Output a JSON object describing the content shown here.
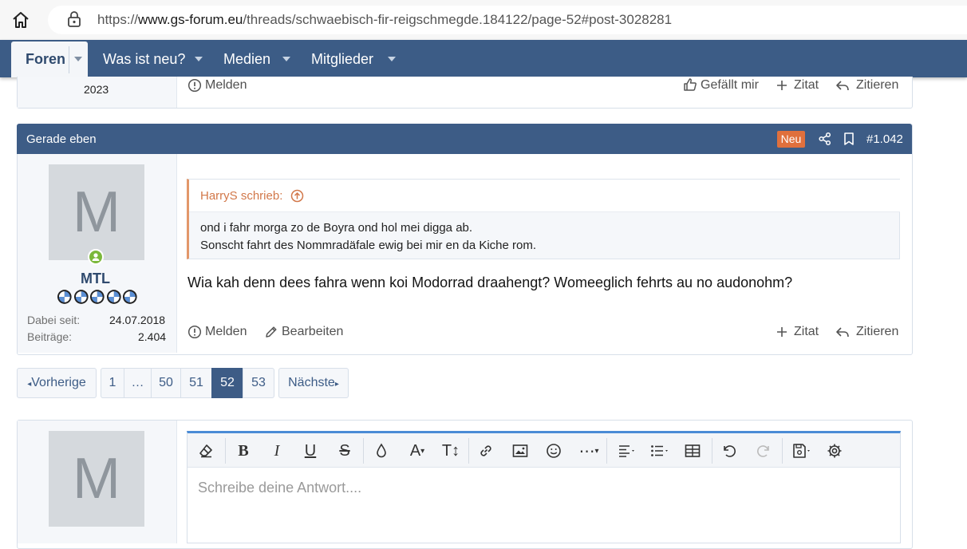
{
  "browser": {
    "url_prefix": "https://",
    "url_host": "www.gs-forum.eu",
    "url_path": "/threads/schwaebisch-fir-reigschmegde.184122/page-52#post-3028281"
  },
  "nav": {
    "items": [
      "Foren",
      "Was ist neu?",
      "Medien",
      "Mitglieder"
    ]
  },
  "prev_post": {
    "user_year": "2023",
    "report_label": "Melden",
    "like_label": "Gefällt mir",
    "add_quote_label": "Zitat",
    "reply_label": "Zitieren"
  },
  "post": {
    "time": "Gerade eben",
    "new_badge": "Neu",
    "number": "#1.042",
    "avatar_letter": "M",
    "username": "MTL",
    "joined_label": "Dabei seit:",
    "joined_value": "24.07.2018",
    "posts_label": "Beiträge:",
    "posts_value": "2.404",
    "quote_author": "HarryS schrieb:",
    "quote_lines": [
      "ond i fahr morga zo de Boyra ond hol mei digga ab.",
      "Sonscht fahrt des Nommradäfale ewig bei mir en da Kiche rom."
    ],
    "body": "Wia kah denn dees fahra wenn koi Modorrad draahengt? Womeeglich fehrts au no audonohm?",
    "report_label": "Melden",
    "edit_label": "Bearbeiten",
    "add_quote_label": "Zitat",
    "reply_label": "Zitieren"
  },
  "pagination": {
    "prev_label": "Vorherige",
    "next_label": "Nächste",
    "pages": [
      "1",
      "…",
      "50",
      "51",
      "52",
      "53"
    ],
    "current": "52"
  },
  "reply": {
    "avatar_letter": "M",
    "placeholder": "Schreibe deine Antwort...."
  },
  "colors": {
    "nav_bg": "#3c5c86",
    "new_badge": "#e0703d",
    "quote_accent": "#e2976a",
    "username": "#2f4a6e",
    "online": "#7bb83b"
  }
}
